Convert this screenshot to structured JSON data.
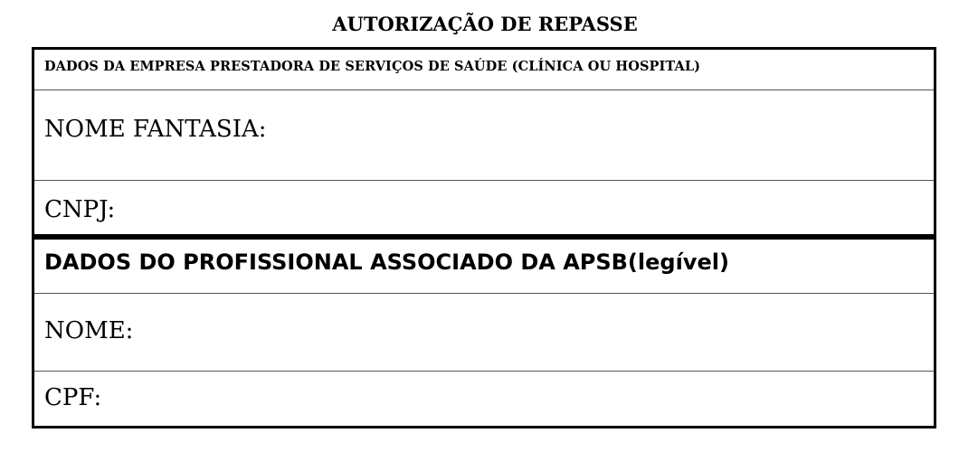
{
  "document": {
    "title": "AUTORIZAÇÃO DE REPASSE"
  },
  "company_section": {
    "header": "DADOS DA EMPRESA PRESTADORA DE SERVIÇOS DE SAÚDE (CLÍNICA OU HOSPITAL)",
    "fields": {
      "nome_fantasia_label": "NOME FANTASIA:",
      "cnpj_label": "CNPJ:"
    }
  },
  "professional_section": {
    "header": "DADOS DO PROFISSIONAL ASSOCIADO DA APSB(legível)",
    "fields": {
      "nome_label": "NOME:",
      "cpf_label": "CPF:"
    }
  }
}
